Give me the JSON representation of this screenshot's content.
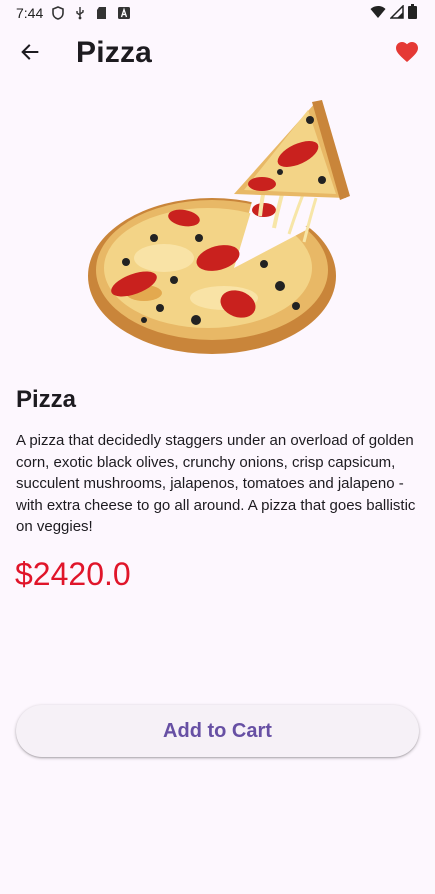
{
  "status_bar": {
    "time": "7:44",
    "left_icons": [
      "shield-icon",
      "usb-icon",
      "sd-card-icon",
      "a-badge-icon"
    ],
    "right_icons": [
      "wifi-icon",
      "signal-icon",
      "battery-icon"
    ]
  },
  "app_bar": {
    "title": "Pizza",
    "back_icon": "arrow-back-icon",
    "favorite_icon": "heart-icon",
    "favorite_color": "#e53935",
    "favorited": true
  },
  "product": {
    "image_alt": "pizza-image",
    "name": "Pizza",
    "description": "A pizza that decidedly staggers under an overload of golden corn, exotic black olives, crunchy onions, crisp capsicum, succulent mushrooms, jalapenos, tomatoes and jalapeno - with extra cheese to go all around. A pizza that goes ballistic on veggies!",
    "price": "$2420.0",
    "price_color": "#e0152a"
  },
  "actions": {
    "add_to_cart_label": "Add to Cart",
    "accent_color": "#6750a4"
  }
}
